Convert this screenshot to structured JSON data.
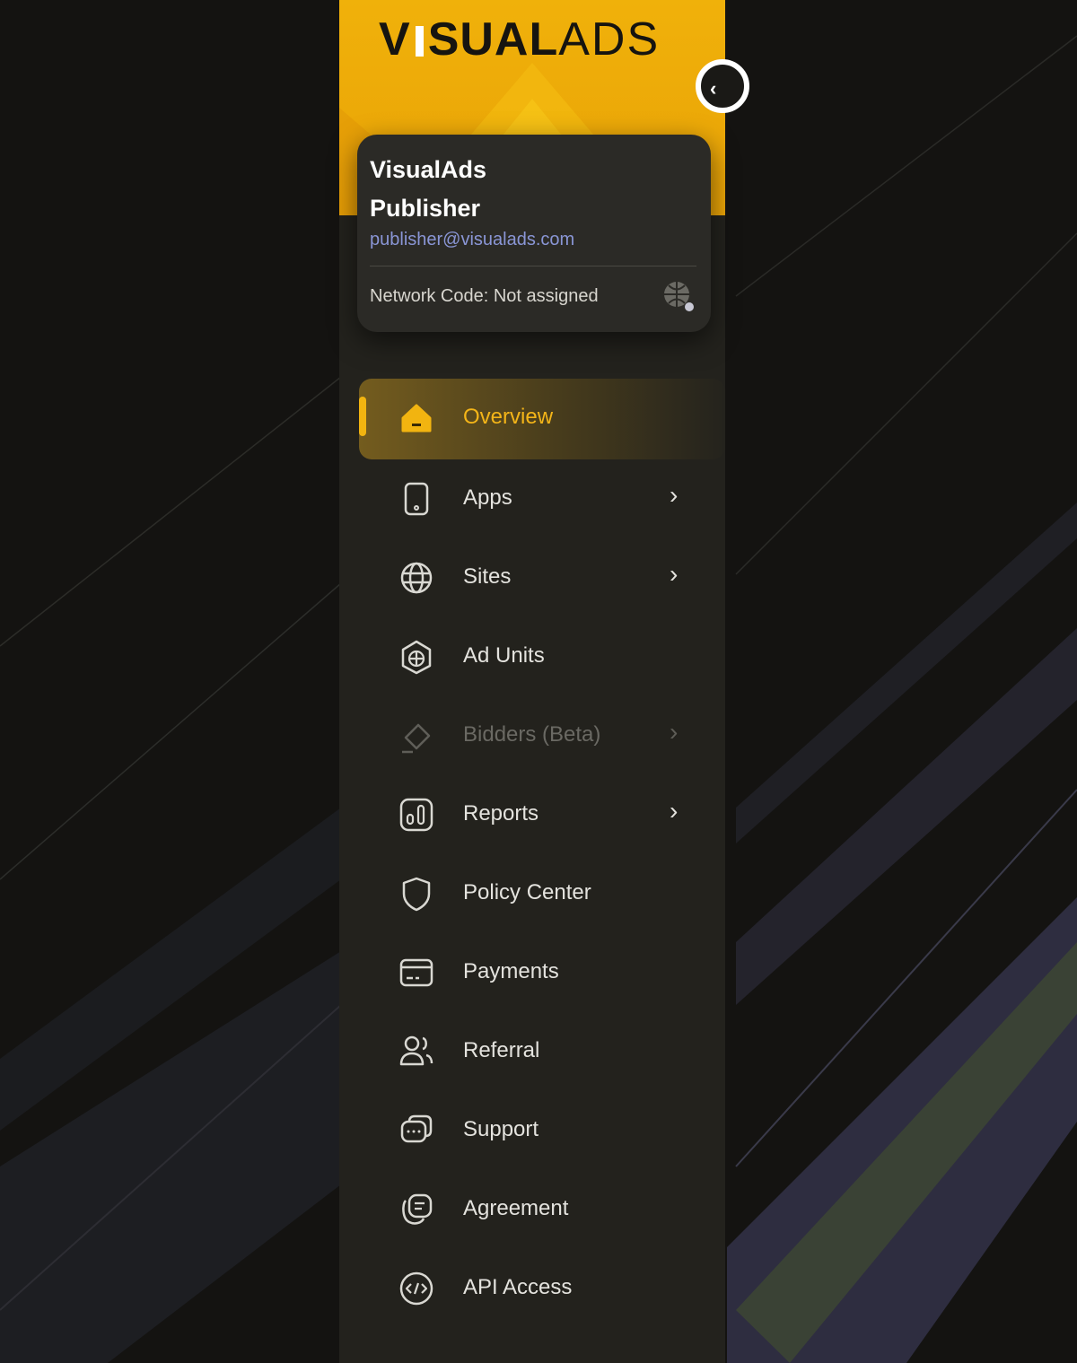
{
  "logo": {
    "part1": "V",
    "part2": "SUAL",
    "part3": "ADS"
  },
  "collapse_button": {
    "icon": "chevron-left-icon"
  },
  "account": {
    "name_line1": "VisualAds",
    "name_line2": "Publisher",
    "email": "publisher@visualads.com",
    "network_code": "Network Code: Not assigned",
    "network_icon": "globe-search-icon"
  },
  "nav": {
    "items": [
      {
        "label": "Overview",
        "icon": "home-icon",
        "active": true,
        "chevron": false
      },
      {
        "label": "Apps",
        "icon": "phone-icon",
        "chevron": true
      },
      {
        "label": "Sites",
        "icon": "globe-icon",
        "chevron": true
      },
      {
        "label": "Ad Units",
        "icon": "ad-unit-icon",
        "chevron": false
      },
      {
        "label": "Bidders (Beta)",
        "icon": "bidders-icon",
        "disabled": true,
        "chevron": true
      },
      {
        "label": "Reports",
        "icon": "reports-icon",
        "chevron": true
      },
      {
        "label": "Policy Center",
        "icon": "shield-icon",
        "chevron": false
      },
      {
        "label": "Payments",
        "icon": "card-icon",
        "chevron": false
      },
      {
        "label": "Referral",
        "icon": "users-icon",
        "chevron": false
      },
      {
        "label": "Support",
        "icon": "chat-icon",
        "chevron": false
      },
      {
        "label": "Agreement",
        "icon": "agreement-icon",
        "chevron": false
      },
      {
        "label": "API Access",
        "icon": "code-icon",
        "chevron": false
      }
    ],
    "chevron_glyph": "›"
  },
  "colors": {
    "accent": "#f2b410",
    "panel": "#23221d",
    "email": "#8a96d6"
  }
}
